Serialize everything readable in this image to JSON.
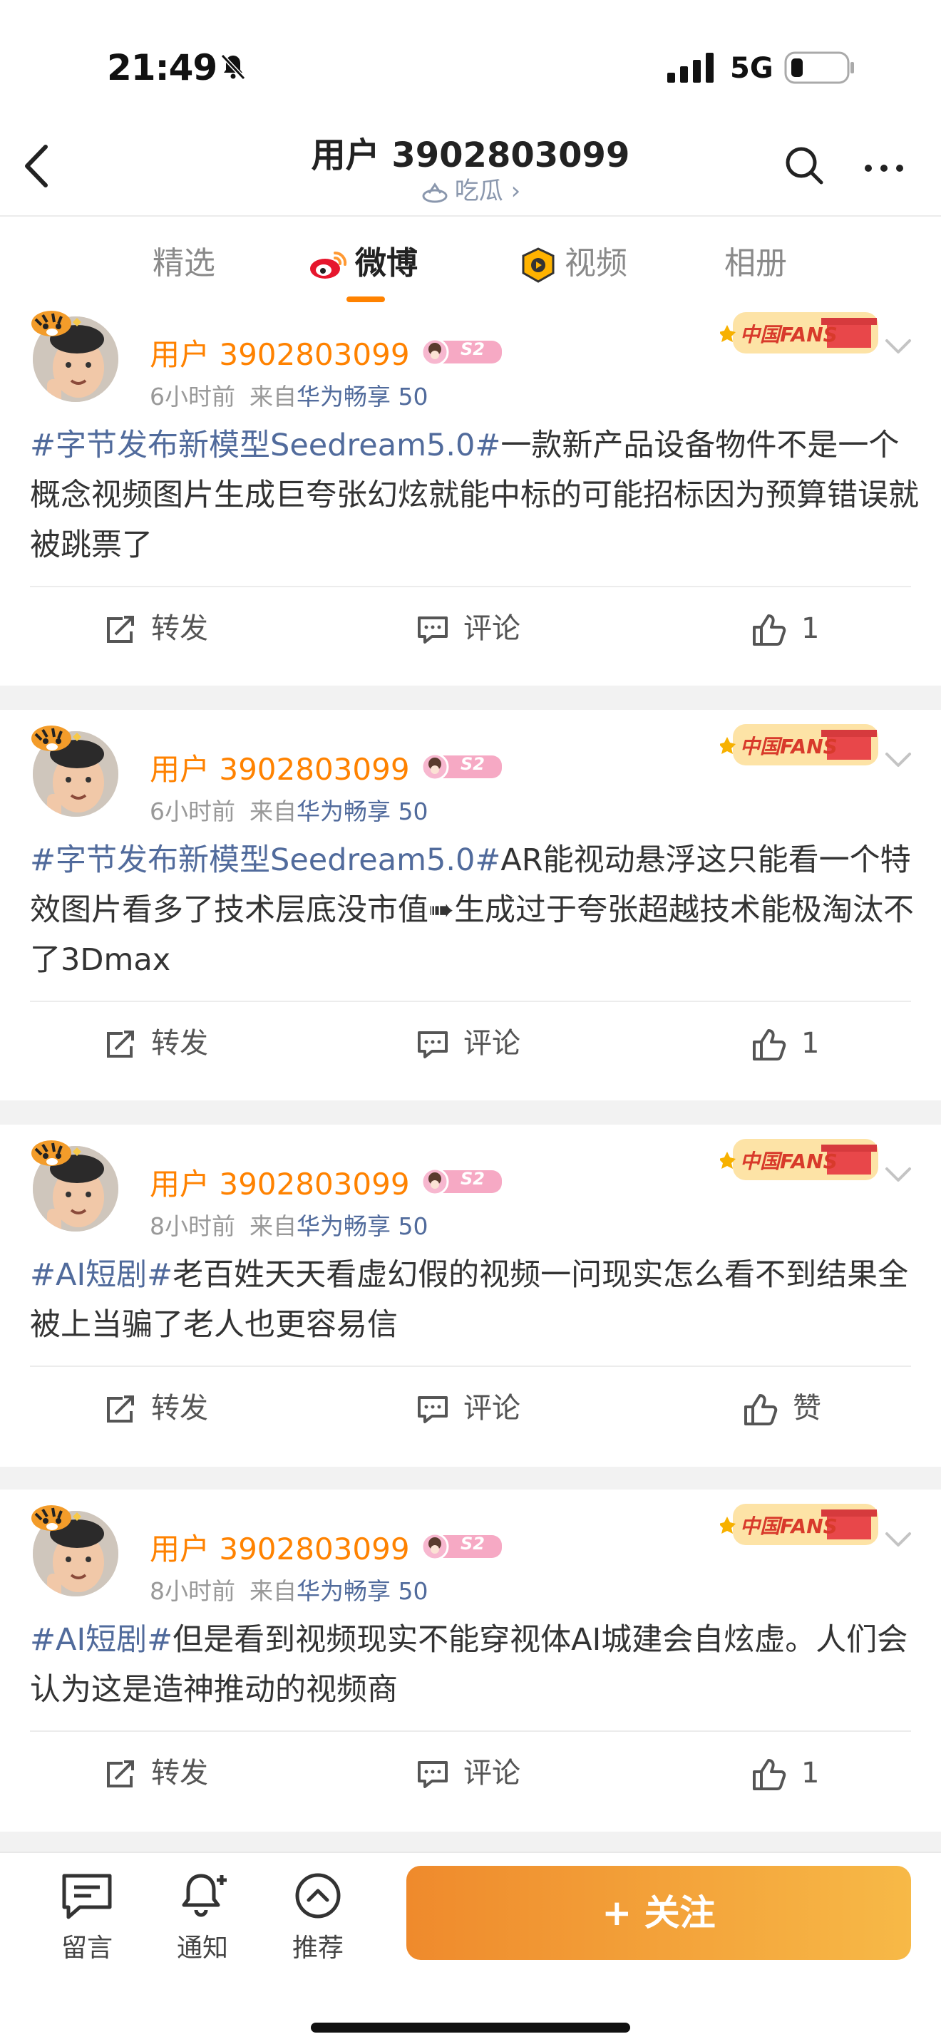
{
  "status_bar": {
    "time": "21:49",
    "network": "5G"
  },
  "header": {
    "title": "用户 3902803099",
    "subtitle": "吃瓜 ›"
  },
  "tabs": [
    {
      "label": "精选"
    },
    {
      "label": "微博"
    },
    {
      "label": "视频"
    },
    {
      "label": "相册"
    }
  ],
  "badge_text": "S2",
  "fans_badge_text": "中国FANS",
  "posts": [
    {
      "username": "用户 3902803099",
      "time": "6小时前",
      "from_label": "来自",
      "device": "华为畅享 50",
      "topic": "#字节发布新模型Seedream5.0#",
      "text": "一款新产品设备物件不是一个概念视频图片生成巨夸张幻炫就能中标的可能招标因为预算错误就被跳票了",
      "repost": "转发",
      "comment": "评论",
      "like": "1"
    },
    {
      "username": "用户 3902803099",
      "time": "6小时前",
      "from_label": "来自",
      "device": "华为畅享 50",
      "topic": "#字节发布新模型Seedream5.0#",
      "text": "AR能视动悬浮这只能看一个特效图片看多了技术层底没市值➠生成过于夸张超越技术能极淘汰不了3Dmax",
      "repost": "转发",
      "comment": "评论",
      "like": "1"
    },
    {
      "username": "用户 3902803099",
      "time": "8小时前",
      "from_label": "来自",
      "device": "华为畅享 50",
      "topic": "#AI短剧#",
      "text": "老百姓天天看虚幻假的视频一问现实怎么看不到结果全被上当骗了老人也更容易信",
      "repost": "转发",
      "comment": "评论",
      "like": "赞"
    },
    {
      "username": "用户 3902803099",
      "time": "8小时前",
      "from_label": "来自",
      "device": "华为畅享 50",
      "topic": "#AI短剧#",
      "text": "但是看到视频现实不能穿视体AI城建会自炫虚。人们会认为这是造神推动的视频商",
      "repost": "转发",
      "comment": "评论",
      "like": "1"
    }
  ],
  "bottom_bar": {
    "message": "留言",
    "notify": "通知",
    "recommend": "推荐",
    "follow": "+ 关注"
  },
  "colors": {
    "accent": "#ff8200",
    "topic": "#516b9c",
    "follow_start": "#ef8a2c",
    "follow_end": "#f7b947"
  },
  "icons": [
    "bell-muted-icon",
    "signal-icon",
    "battery-icon",
    "back-icon",
    "search-icon",
    "more-icon",
    "weibo-icon",
    "video-icon",
    "repost-icon",
    "comment-icon",
    "like-icon",
    "chevron-down-icon",
    "message-icon",
    "notify-icon",
    "recommend-icon"
  ]
}
